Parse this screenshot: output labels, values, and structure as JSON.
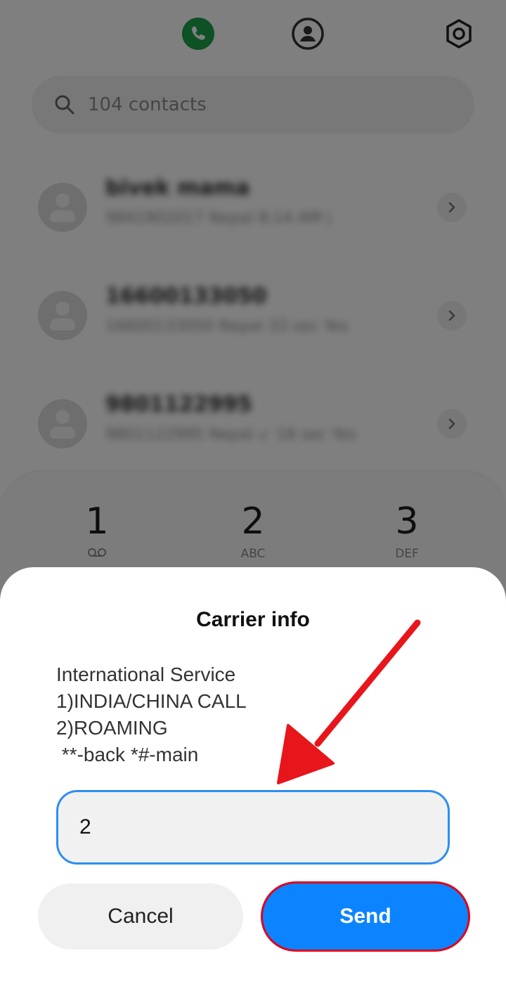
{
  "tabs": {
    "phone_icon": "phone-icon",
    "contacts_icon": "contacts-icon",
    "settings_icon": "settings-icon",
    "active_color": "#1aa34a"
  },
  "search": {
    "placeholder": "104 contacts"
  },
  "contacts": [
    {
      "name": "bivek mama",
      "detail": "9841902017  Nepal      8:14 AM  |"
    },
    {
      "name": "16600133050",
      "detail": "16600133050 Nepal   33 sec  Yes"
    },
    {
      "name": "9801122995",
      "detail": "9801122995 Nepal  ↙ 18 sec Yes"
    }
  ],
  "keypad": {
    "keys": [
      {
        "digit": "1",
        "letters": "",
        "icon": "voicemail-icon"
      },
      {
        "digit": "2",
        "letters": "ABC"
      },
      {
        "digit": "3",
        "letters": "DEF"
      }
    ]
  },
  "dialog": {
    "title": "Carrier info",
    "message": "International Service\n1)INDIA/CHINA CALL\n2)ROAMING\n **-back *#-main",
    "input_value": "2",
    "cancel_label": "Cancel",
    "send_label": "Send"
  },
  "colors": {
    "send_button": "#0d84ff",
    "input_border": "#2d8ef0",
    "annotation_red": "#e0001a"
  }
}
